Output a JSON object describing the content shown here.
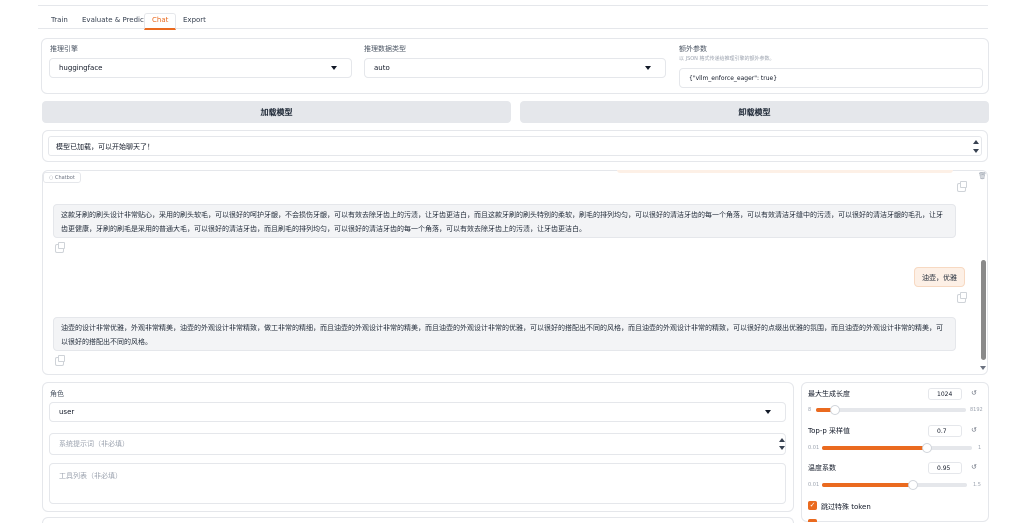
{
  "tabs": [
    {
      "label": "Train"
    },
    {
      "label": "Evaluate & Predict"
    },
    {
      "label": "Chat"
    },
    {
      "label": "Export"
    }
  ],
  "active_tab": "Chat",
  "accent_color": "#ea6a1f",
  "infer": {
    "backend_label": "推理引擎",
    "backend_value": "huggingface",
    "dtype_label": "推理数据类型",
    "dtype_value": "auto",
    "extra_label": "额外参数",
    "extra_hint": "以 JSON 格式传递给推理引擎的额外参数。",
    "extra_value": "{\"vllm_enforce_eager\": true}"
  },
  "buttons": {
    "load": "加载模型",
    "unload": "卸载模型"
  },
  "status_text": "模型已加载，可以开始聊天了！",
  "chatbot": {
    "label": "Chatbot",
    "messages": [
      {
        "role": "bot",
        "text": "这款牙刷的刷头设计非常贴心，采用的刷头软毛，可以很好的呵护牙龈，不会损伤牙龈，可以有效去除牙齿上的污渍，让牙齿更洁白，而且这款牙刷的刷头特别的柔软，刷毛的排列均匀，可以很好的清洁牙齿的每一个角落，可以有效清洁牙缝中的污渍，可以很好的清洁牙龈的毛孔，让牙齿更健康，牙刷的刷毛是采用的普通大毛，可以很好的清洁牙齿，而且刷毛的排列均匀，可以很好的清洁牙齿的每一个角落，可以有效去除牙齿上的污渍，让牙齿更洁白。"
      },
      {
        "role": "user",
        "text": "油壶，优雅"
      },
      {
        "role": "bot",
        "text": "油壶的设计非常优雅，外观非常精美，油壶的外观设计非常精致，做工非常的精细，而且油壶的外观设计非常的精美，而且油壶的外观设计非常的优雅，可以很好的搭配出不同的风格，而且油壶的外观设计非常的精致，可以很好的点缀出优雅的氛围，而且油壶的外观设计非常的精美，可以很好的搭配出不同的风格。"
      }
    ]
  },
  "role": {
    "label": "角色",
    "value": "user"
  },
  "system_prompt_placeholder": "系统提示词（非必填）",
  "tools_placeholder": "工具列表（非必填）",
  "params": {
    "max_new_tokens": {
      "label": "最大生成长度",
      "value": "1024",
      "min": "8",
      "max": "8192",
      "fraction": 0.124
    },
    "top_p": {
      "label": "Top-p 采样值",
      "value": "0.7",
      "min": "0.01",
      "max": "1",
      "fraction": 0.697
    },
    "temperature": {
      "label": "温度系数",
      "value": "0.95",
      "min": "0.01",
      "max": "1.5",
      "fraction": 0.631
    },
    "skip_special_tokens": {
      "label": "跳过特殊 token",
      "checked": true
    }
  }
}
